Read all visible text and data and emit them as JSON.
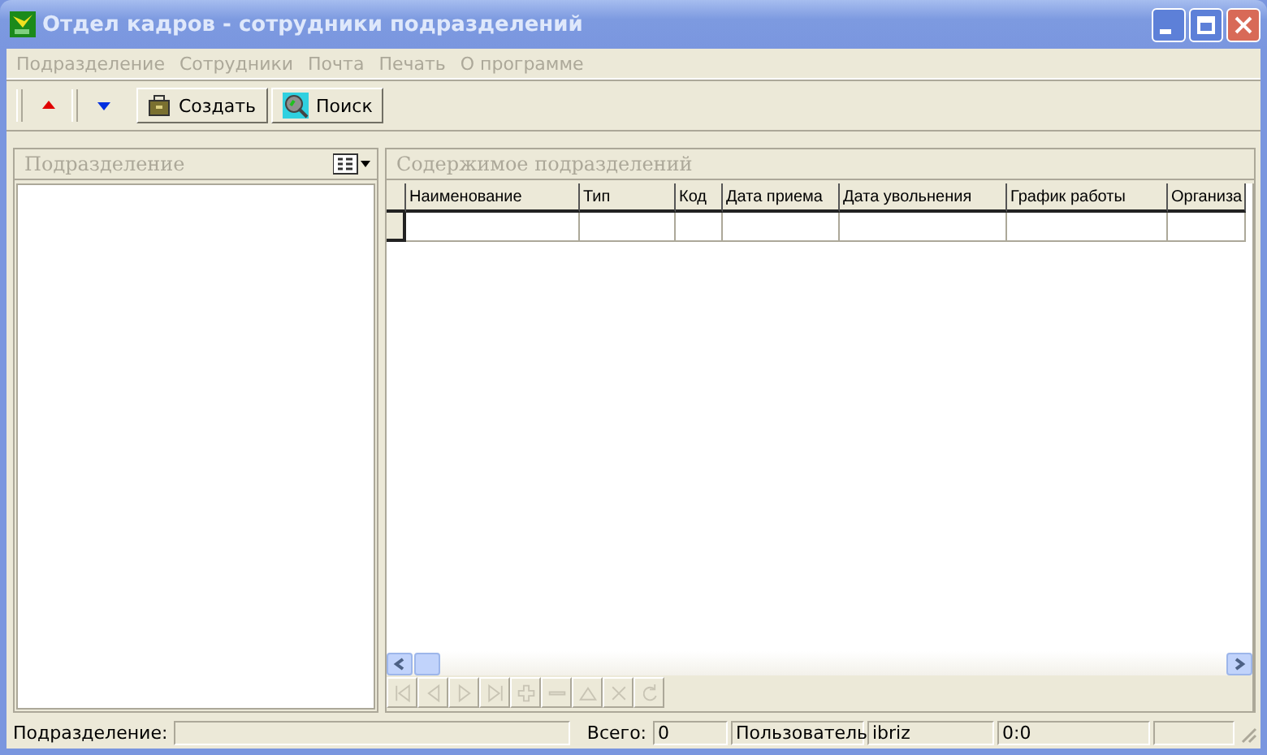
{
  "window": {
    "title": "Отдел кадров - сотрудники подразделений"
  },
  "menu": [
    {
      "label": "Подразделение",
      "disabled": true
    },
    {
      "label": "Сотрудники",
      "disabled": true
    },
    {
      "label": "Почта",
      "disabled": true
    },
    {
      "label": "Печать",
      "disabled": true
    },
    {
      "label": "О программе",
      "disabled": true
    }
  ],
  "toolbar": [
    {
      "kind": "up"
    },
    {
      "kind": "down"
    },
    {
      "kind": "create",
      "label": "Создать"
    },
    {
      "kind": "search",
      "label": "Поиск"
    }
  ],
  "left_panel": {
    "title": "Подразделение"
  },
  "right_panel": {
    "title": "Содержимое подразделений",
    "columns": [
      "Наименование",
      "Тип",
      "Код",
      "Дата приема",
      "Дата увольнения",
      "График работы",
      "Организа"
    ],
    "navigator": [
      {
        "kind": "first",
        "disabled": true
      },
      {
        "kind": "prev",
        "disabled": true
      },
      {
        "kind": "next",
        "disabled": true
      },
      {
        "kind": "last",
        "disabled": true
      },
      {
        "kind": "add",
        "disabled": true
      },
      {
        "kind": "delete",
        "disabled": true
      },
      {
        "kind": "edit",
        "disabled": true
      },
      {
        "kind": "cancel",
        "disabled": true
      },
      {
        "kind": "refresh",
        "disabled": true
      }
    ]
  },
  "status_bar": {
    "department_label": "Подразделение:",
    "total_label": "Всего:",
    "total": "0",
    "user_label": "Пользователь",
    "user": "ibriz",
    "position": "0:0"
  }
}
